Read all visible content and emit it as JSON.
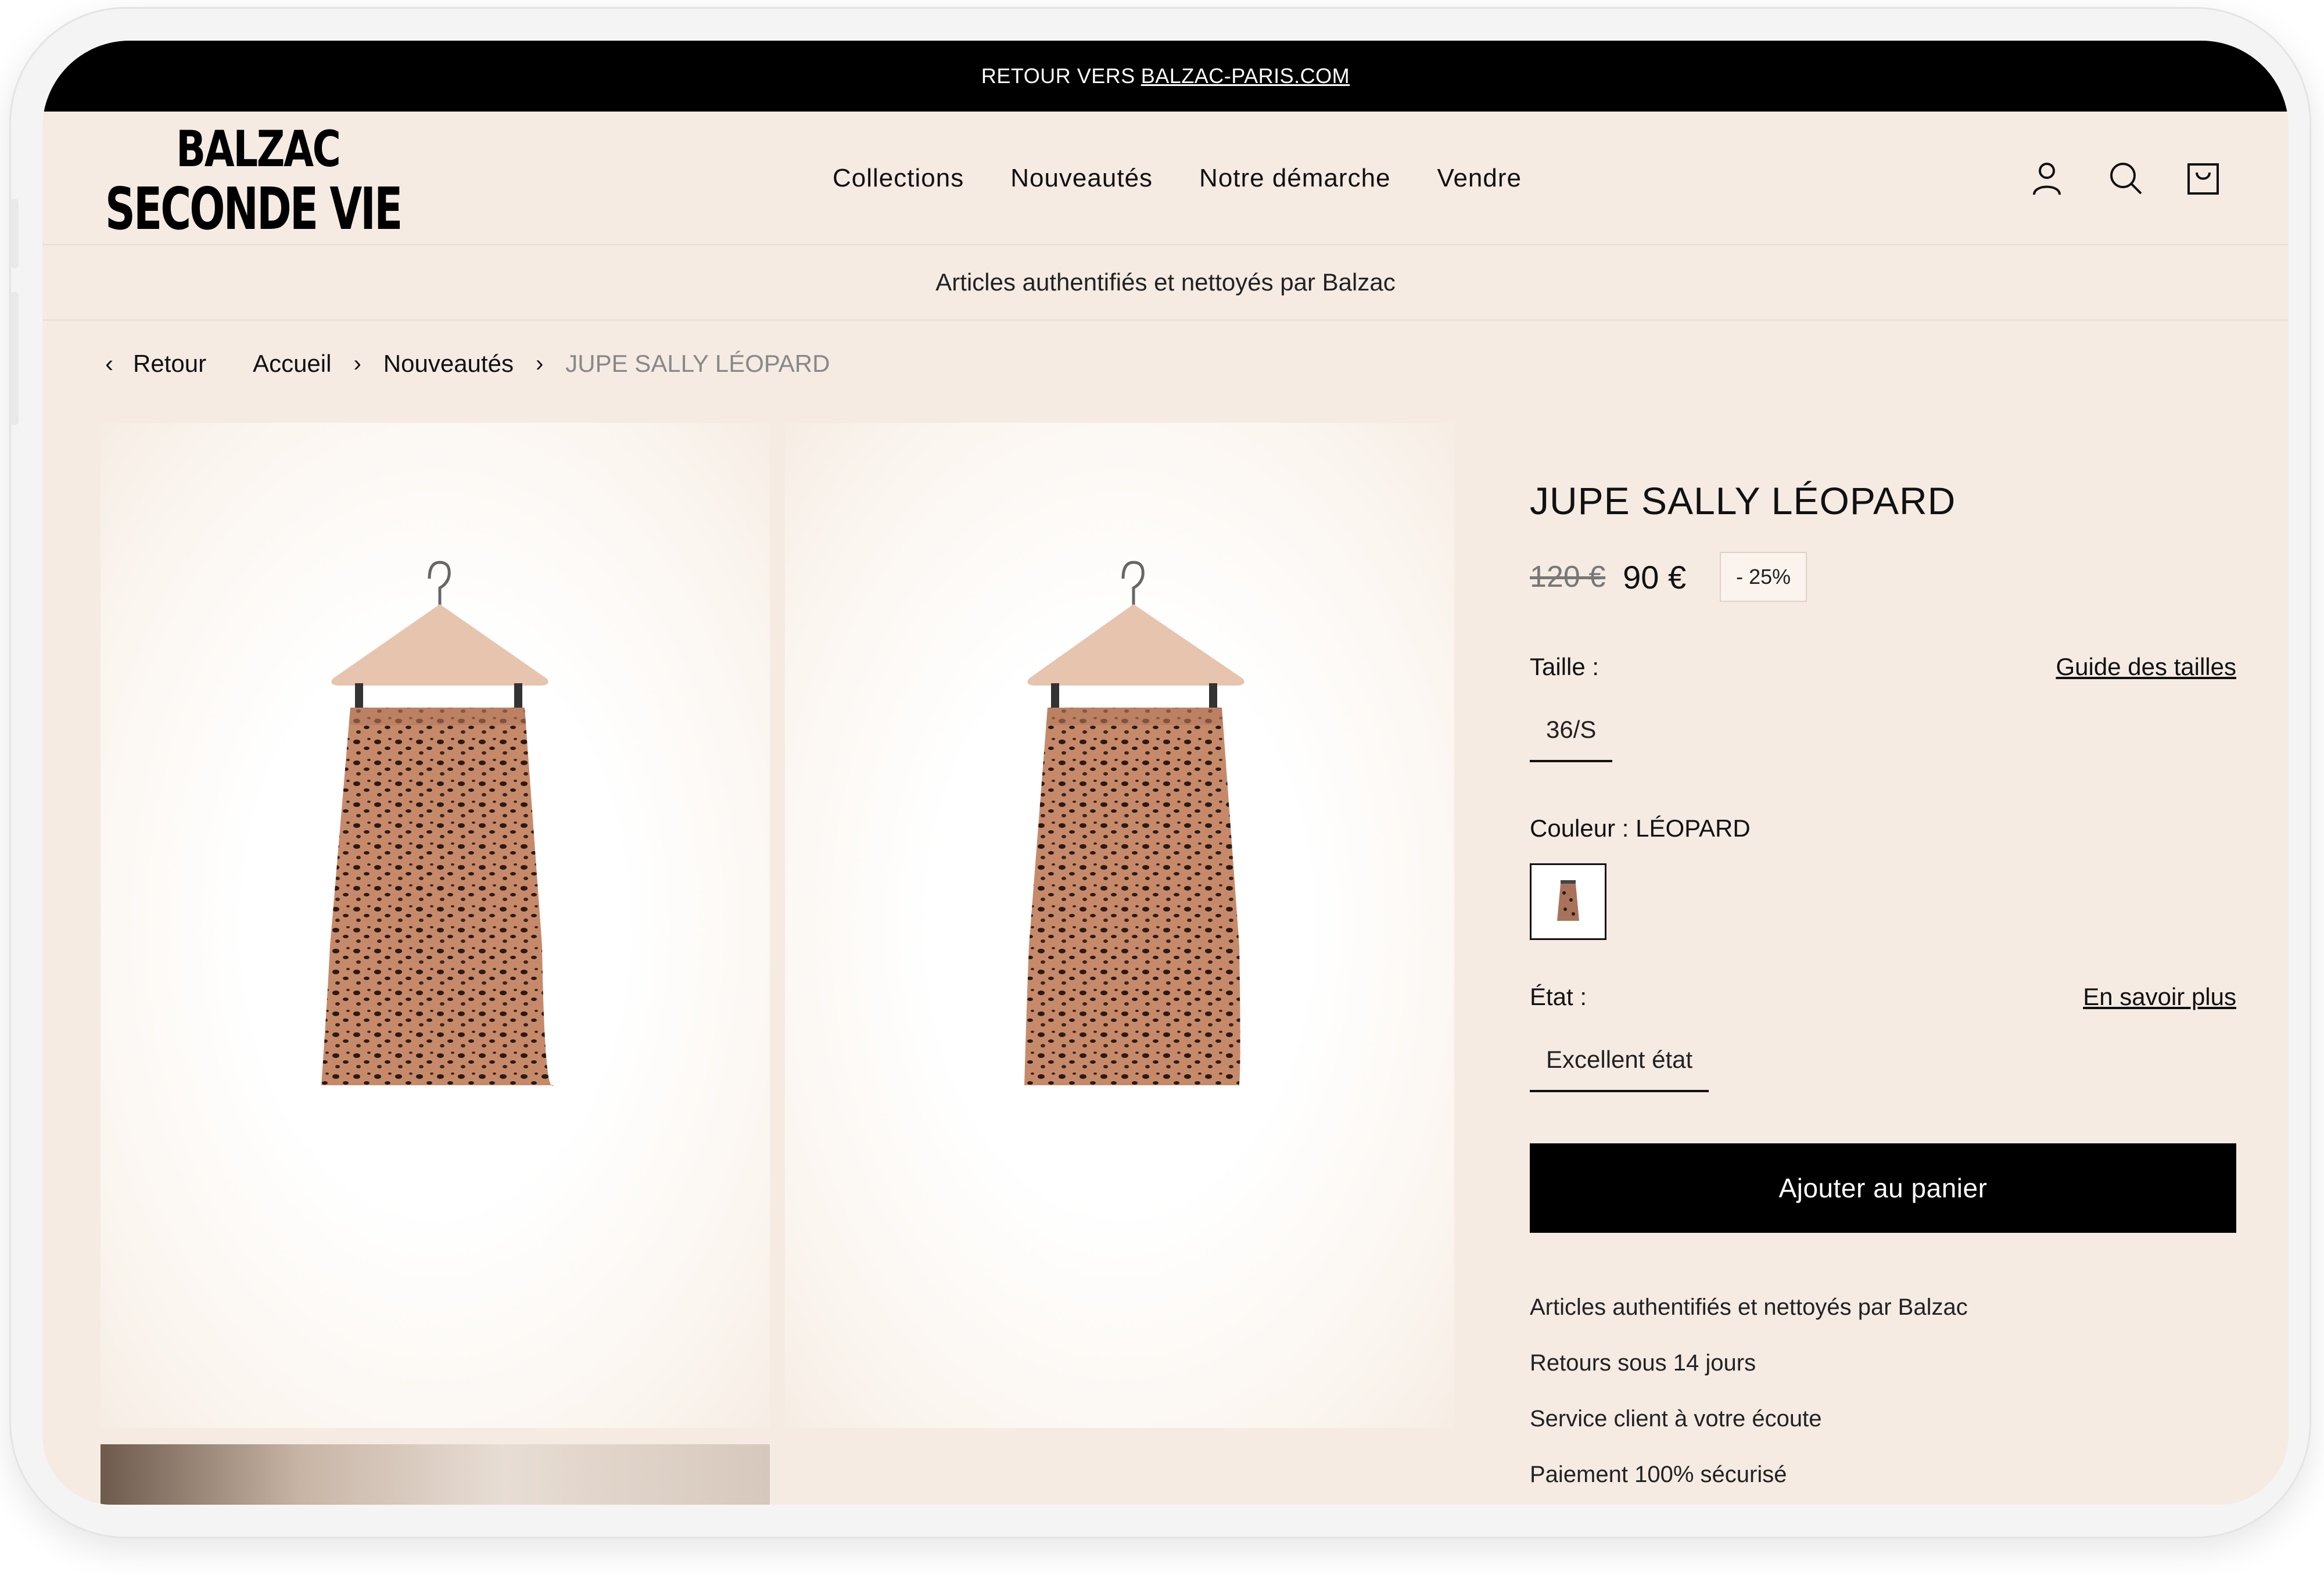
{
  "topbar": {
    "prefix": "RETOUR VERS",
    "link": "BALZAC-PARIS.COM"
  },
  "logo": {
    "line1": "BALZAC",
    "line2": "SECONDE VIE"
  },
  "nav": [
    "Collections",
    "Nouveautés",
    "Notre démarche",
    "Vendre"
  ],
  "header_icons": [
    "account-icon",
    "search-icon",
    "cart-icon"
  ],
  "trust_strip": "Articles authentifiés et nettoyés par Balzac",
  "breadcrumb": {
    "back": "Retour",
    "items": [
      "Accueil",
      "Nouveautés"
    ],
    "current": "JUPE SALLY LÉOPARD"
  },
  "product": {
    "title": "JUPE SALLY LÉOPARD",
    "old_price": "120 €",
    "price": "90 €",
    "discount": "- 25%",
    "size_label": "Taille :",
    "size_guide": "Guide des tailles",
    "size": "36/S",
    "color_label": "Couleur : LÉOPARD",
    "condition_label": "État :",
    "condition_more": "En savoir plus",
    "condition": "Excellent état",
    "add_to_cart": "Ajouter au panier",
    "perks": [
      "Articles authentifiés et nettoyés par Balzac",
      "Retours sous 14 jours",
      "Service client à votre écoute",
      "Paiement 100% sécurisé"
    ]
  },
  "colors": {
    "topbar": "#000000",
    "page_bg": "#f5ebe3",
    "button": "#000000",
    "leopard": "#c0876b"
  }
}
